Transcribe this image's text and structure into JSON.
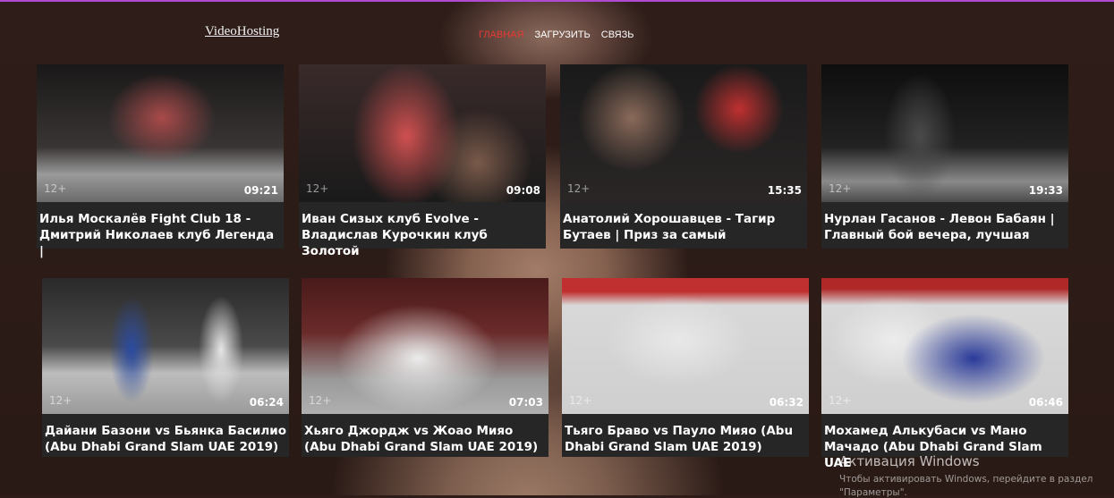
{
  "header": {
    "logo": "VideoHosting",
    "nav": [
      {
        "label": "ГЛАВНАЯ",
        "active": true
      },
      {
        "label": "ЗАГРУЗИТЬ",
        "active": false
      },
      {
        "label": "СВЯЗЬ",
        "active": false
      }
    ],
    "active_color": "#e53935"
  },
  "videos": [
    {
      "title": "Илья Москалёв Fight Club 18 - Дмитрий Николаев клуб Легенда |",
      "age": "12+",
      "duration": "09:21"
    },
    {
      "title": "Иван Сизых клуб Evolve - Владислав Курочкин клуб Золотой",
      "age": "12+",
      "duration": "09:08"
    },
    {
      "title": "Анатолий Хорошавцев - Тагир Бутаев | Приз за самый",
      "age": "12+",
      "duration": "15:35"
    },
    {
      "title": "Нурлан Гасанов - Левон Бабаян | Главный бой вечера, лучшая",
      "age": "12+",
      "duration": "19:33"
    },
    {
      "title": "Дайани Базони vs Бьянка Басилио (Abu Dhabi Grand Slam UAE 2019)",
      "age": "12+",
      "duration": "06:24"
    },
    {
      "title": "Хьяго Джордж vs Жоао Мияо (Abu Dhabi Grand Slam UAE 2019)",
      "age": "12+",
      "duration": "07:03"
    },
    {
      "title": "Тьяго Браво vs Пауло Мияо (Abu Dhabi Grand Slam UAE 2019)",
      "age": "12+",
      "duration": "06:32"
    },
    {
      "title": "Мохамед Алькубаси vs Мано Мачадо (Abu Dhabi Grand Slam UAE",
      "age": "12+",
      "duration": "06:46"
    }
  ],
  "windows_watermark": {
    "title": "Активация Windows",
    "line1": "Чтобы активировать Windows, перейдите в раздел",
    "line2": "\"Параметры\"."
  }
}
